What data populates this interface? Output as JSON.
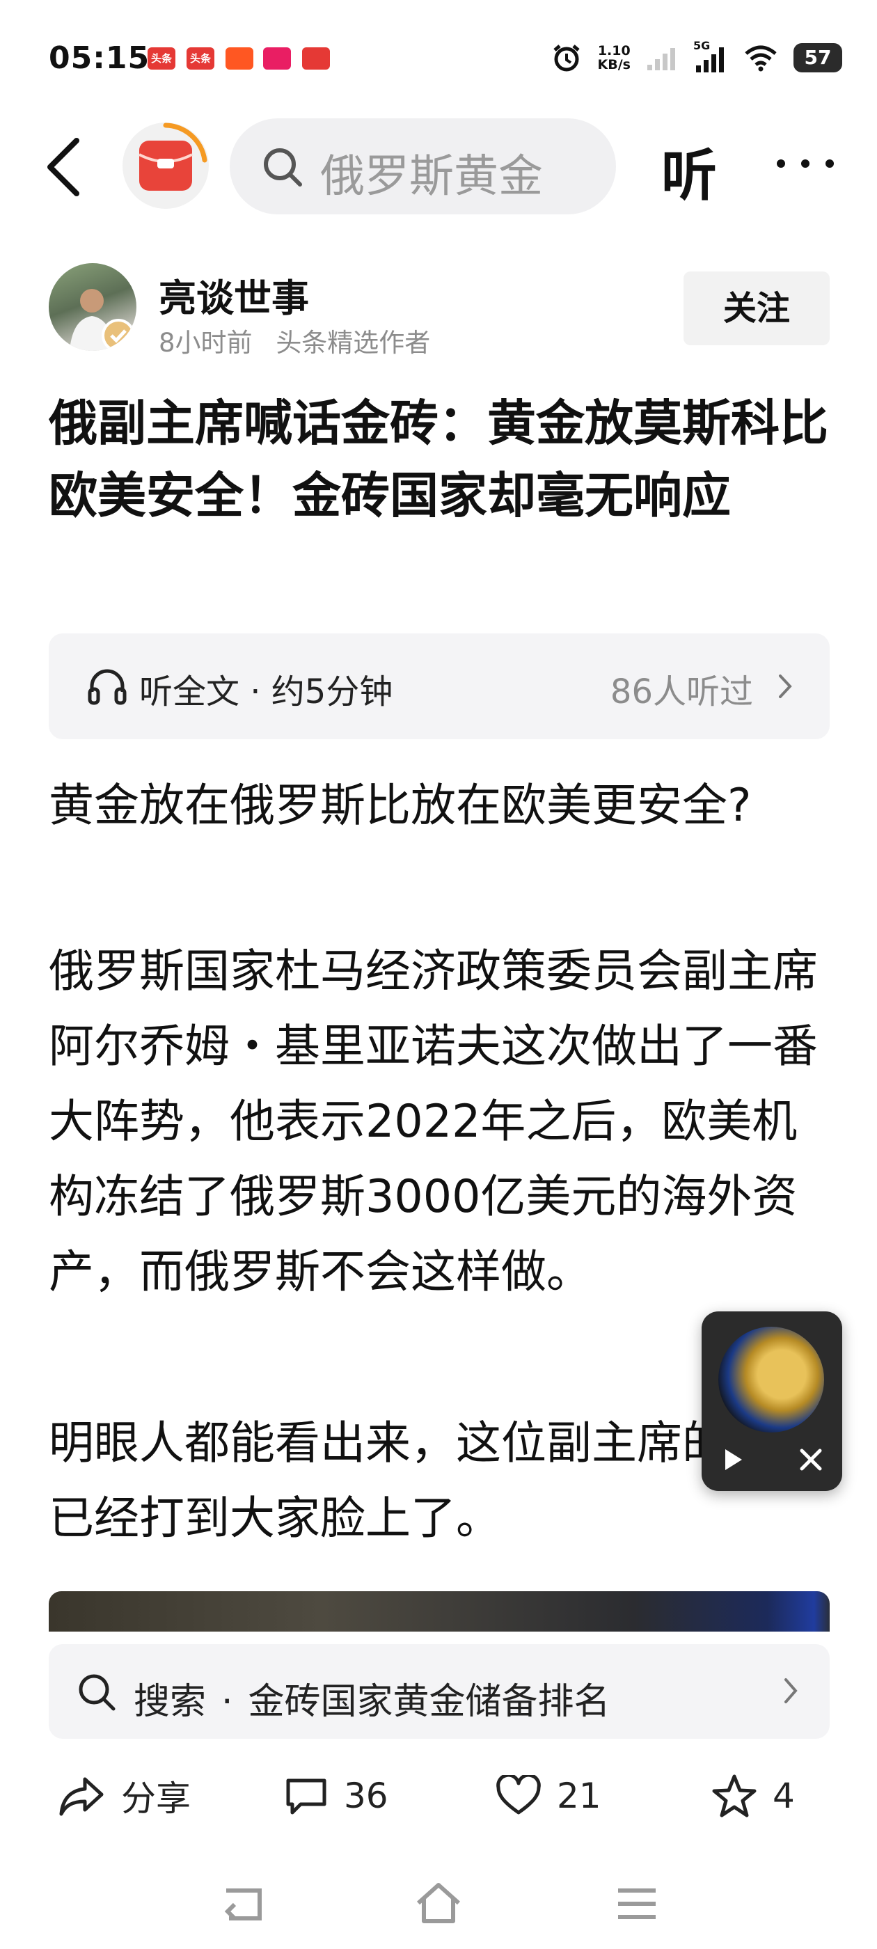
{
  "status_bar": {
    "time": "05:15",
    "notifications": [
      {
        "icon": "toutiao-app-icon",
        "label": "头条",
        "color": "#e53935"
      },
      {
        "icon": "toutiao-app-icon",
        "label": "头条",
        "color": "#e53935"
      },
      {
        "icon": "app-icon",
        "label": "",
        "color": "#ff5722"
      },
      {
        "icon": "app-icon",
        "label": "",
        "color": "#e91e63"
      },
      {
        "icon": "maps-icon",
        "label": "",
        "color": "#e53935"
      }
    ],
    "net_speed_value": "1.10",
    "net_speed_unit": "KB/s",
    "network": "5G",
    "battery": "57"
  },
  "top_bar": {
    "search_text": "俄罗斯黄金",
    "listen_label": "听"
  },
  "author": {
    "name": "亮谈世事",
    "time": "8小时前",
    "badge_text": "头条精选作者",
    "follow_label": "关注"
  },
  "article": {
    "title": "俄副主席喊话金砖：黄金放莫斯科比欧美安全！金砖国家却毫无响应",
    "audio_label": "听全文 · 约5分钟",
    "audio_count": "86人听过",
    "paragraphs": [
      "黄金放在俄罗斯比放在欧美更安全?",
      "俄罗斯国家杜马经济政策委员会副主席阿尔乔姆・基里亚诺夫这次做出了一番大阵势，他表示2022年之后，欧美机构冻结了俄罗斯3000亿美元的海外资产，而俄罗斯不会这样做。",
      "明眼人都能看出来，这位副主席的算盘已经打到大家脸上了。"
    ]
  },
  "search_suggestion": {
    "prefix": "搜索",
    "query": "金砖国家黄金储备排名"
  },
  "actions": {
    "share_label": "分享",
    "comments": "36",
    "likes": "21",
    "favorites": "4"
  },
  "colors": {
    "accent_red": "#e8443a",
    "text_gray": "#8c8c8c"
  }
}
